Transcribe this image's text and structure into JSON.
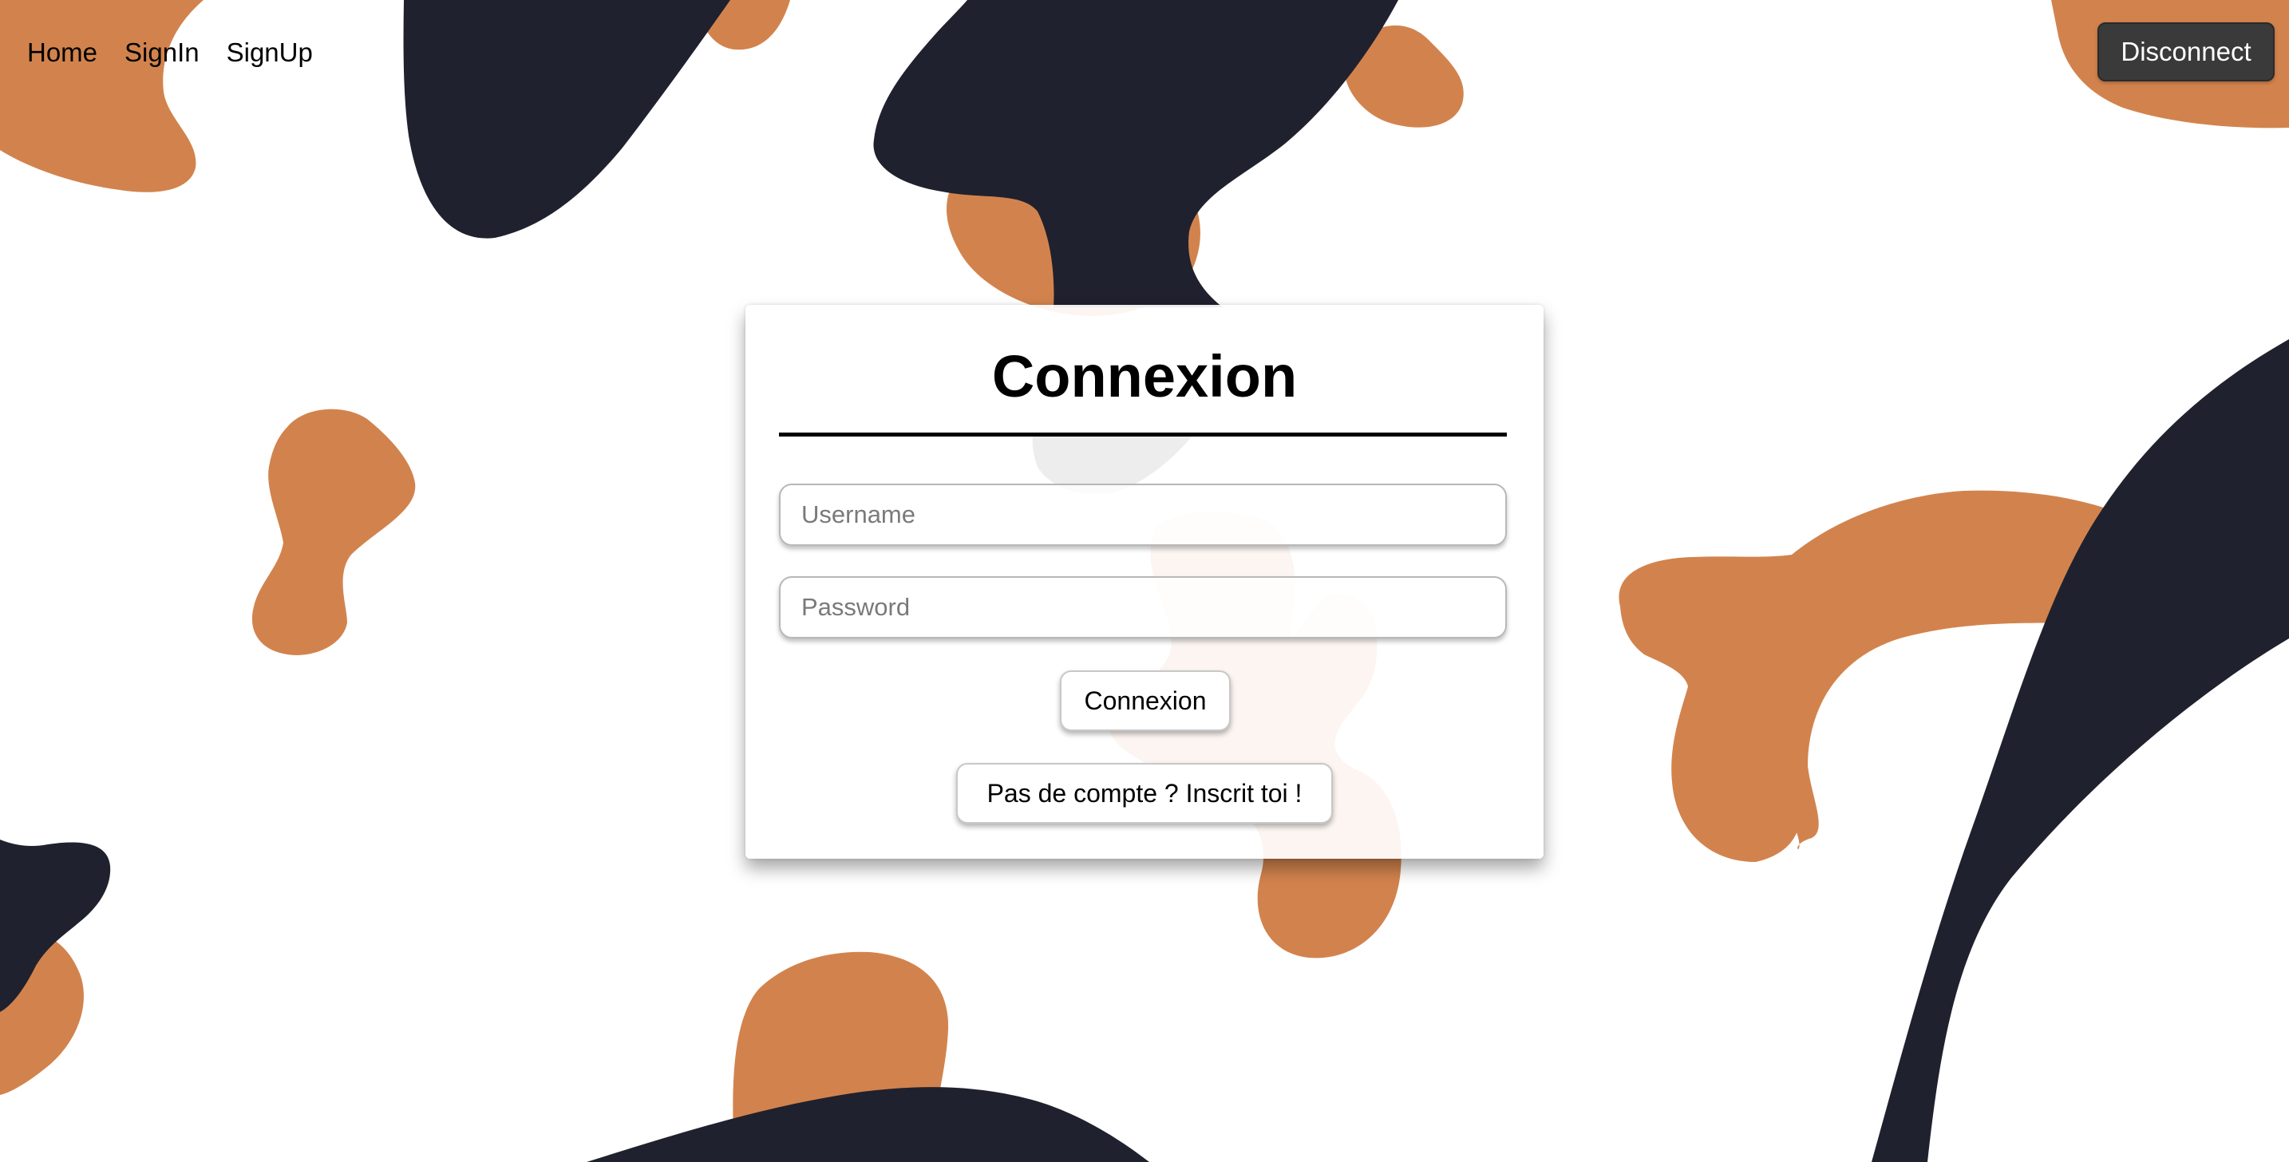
{
  "nav": {
    "items": [
      {
        "label": "Home"
      },
      {
        "label": "SignIn"
      },
      {
        "label": "SignUp"
      }
    ],
    "disconnect_label": "Disconnect"
  },
  "card": {
    "title": "Connexion",
    "username_placeholder": "Username",
    "password_placeholder": "Password",
    "submit_label": "Connexion",
    "signup_label": "Pas de compte ? Inscrit toi !"
  },
  "colors": {
    "orange_blob": "#d2834d",
    "navy_blob": "#20212e",
    "background": "#ffffff"
  }
}
